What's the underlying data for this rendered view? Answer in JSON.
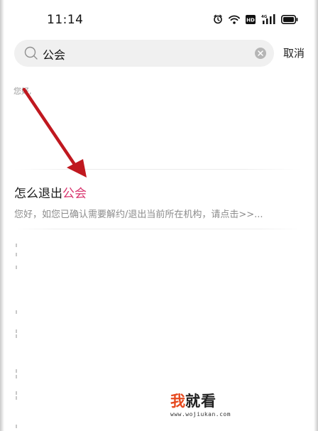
{
  "status_bar": {
    "time": "11:14",
    "icons": [
      "alarm-icon",
      "wifi-icon",
      "hd-icon",
      "signal-4g-icon",
      "battery-icon"
    ],
    "hd_label": "HD",
    "network_label": "4G"
  },
  "search": {
    "query": "公会",
    "cancel_label": "取消"
  },
  "suggestion": {
    "text": "您好,"
  },
  "result": {
    "title_prefix": "怎么退出",
    "title_highlight": "公会",
    "highlight_color": "#d8336d",
    "snippet": "您好，如您已确认需要解约/退出当前所在机构，请点击>>..."
  },
  "annotation": {
    "arrow_color": "#c0181f"
  },
  "watermark": {
    "brand_red": "我",
    "brand_black": "就看",
    "url": "www.wojiukan.com"
  }
}
